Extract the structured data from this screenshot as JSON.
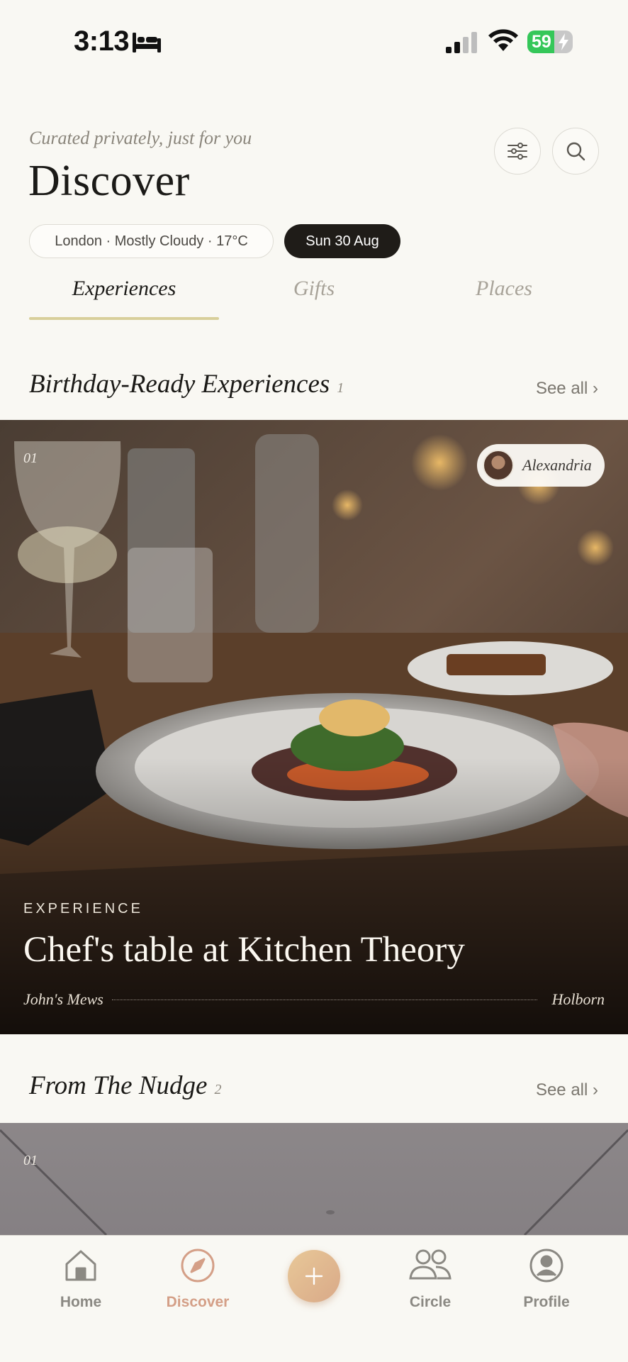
{
  "status_bar": {
    "time": "3:13",
    "battery": "59",
    "battery_level": 0.59,
    "icons": [
      "bed-icon",
      "cellular-signal-icon",
      "wifi-icon",
      "battery-icon",
      "charging-bolt-icon"
    ]
  },
  "header": {
    "subtitle": "Curated privately, just for you",
    "title": "Discover",
    "filter_icon": "sliders-icon",
    "search_icon": "search-icon"
  },
  "chips": {
    "weather": "London · Mostly Cloudy · 17°C",
    "date": "Sun 30 Aug"
  },
  "tabs": [
    {
      "label": "Experiences",
      "active": true
    },
    {
      "label": "Gifts",
      "active": false
    },
    {
      "label": "Places",
      "active": false
    }
  ],
  "sections": [
    {
      "title": "Birthday-Ready Experiences",
      "count": "1",
      "see_all": "See all ›",
      "card": {
        "index": "01",
        "host": "Alexandria",
        "kicker": "EXPERIENCE",
        "title": "Chef's table at Kitchen Theory",
        "location_left": "John's Mews",
        "location_right": "Holborn"
      }
    },
    {
      "title": "From The Nudge",
      "count": "2",
      "see_all": "See all ›",
      "card": {
        "index": "01"
      }
    }
  ],
  "bottom_nav": [
    {
      "label": "Home",
      "icon": "home-icon",
      "active": false
    },
    {
      "label": "Discover",
      "icon": "compass-icon",
      "active": true
    },
    {
      "label": "",
      "icon": "plus-icon",
      "active": false
    },
    {
      "label": "Circle",
      "icon": "people-icon",
      "active": false
    },
    {
      "label": "Profile",
      "icon": "profile-icon",
      "active": false
    }
  ],
  "colors": {
    "background": "#f9f8f3",
    "accent": "#d49f87",
    "tab_underline": "#d8cf9a",
    "dark_chip": "#1f1c18"
  }
}
